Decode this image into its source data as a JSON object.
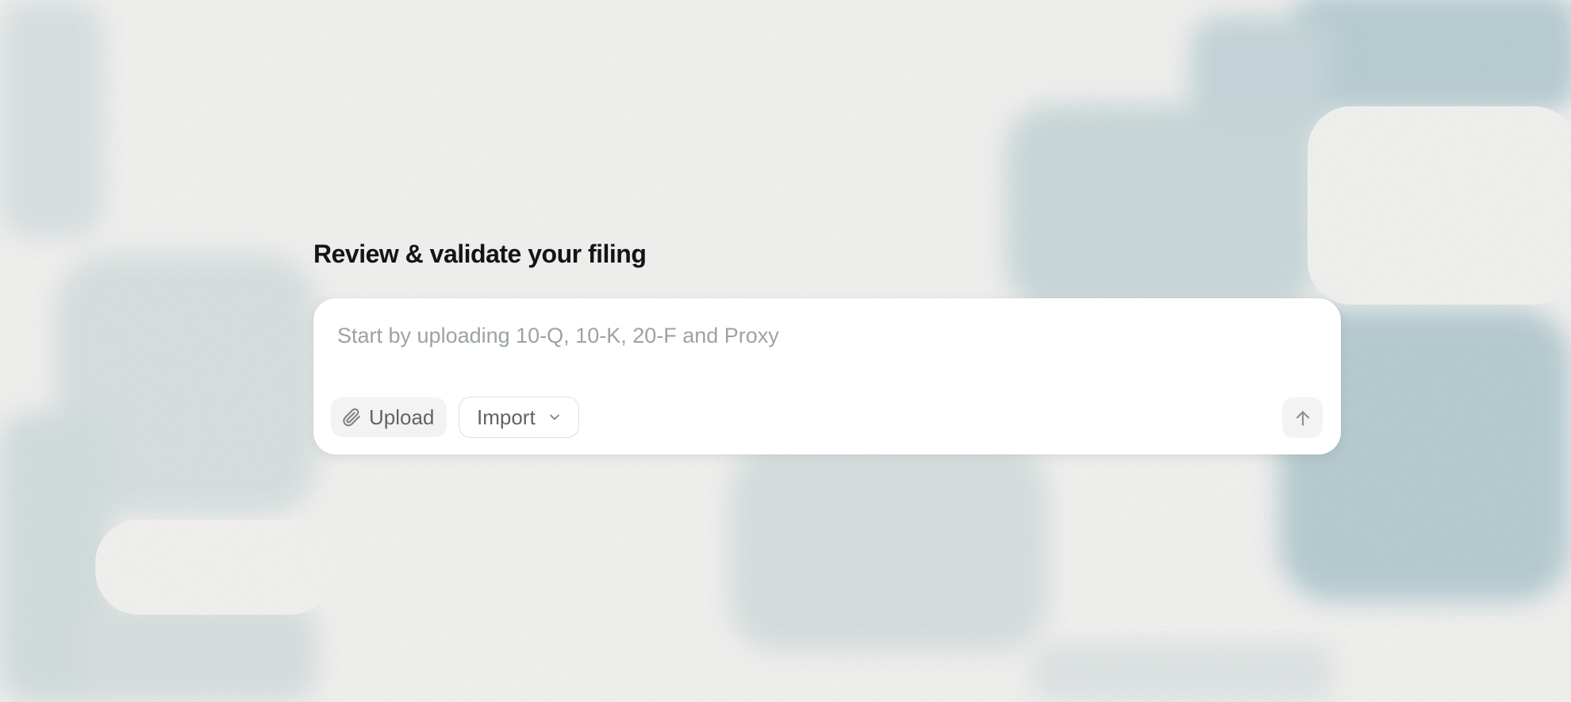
{
  "page": {
    "title": "Review & validate your filing"
  },
  "composer": {
    "placeholder": "Start by uploading 10-Q, 10-K, 20-F and Proxy",
    "value": "",
    "upload_label": "Upload",
    "upload_icon": "paperclip-icon",
    "import_label": "Import",
    "import_icon": "chevron-down-icon",
    "send_icon": "arrow-up-icon"
  },
  "colors": {
    "background": "#f1f0ee",
    "texture": "#b8ccd0",
    "card": "#ffffff",
    "title": "#141414",
    "placeholder": "#9ba3a3",
    "button_text": "#5f6565"
  }
}
